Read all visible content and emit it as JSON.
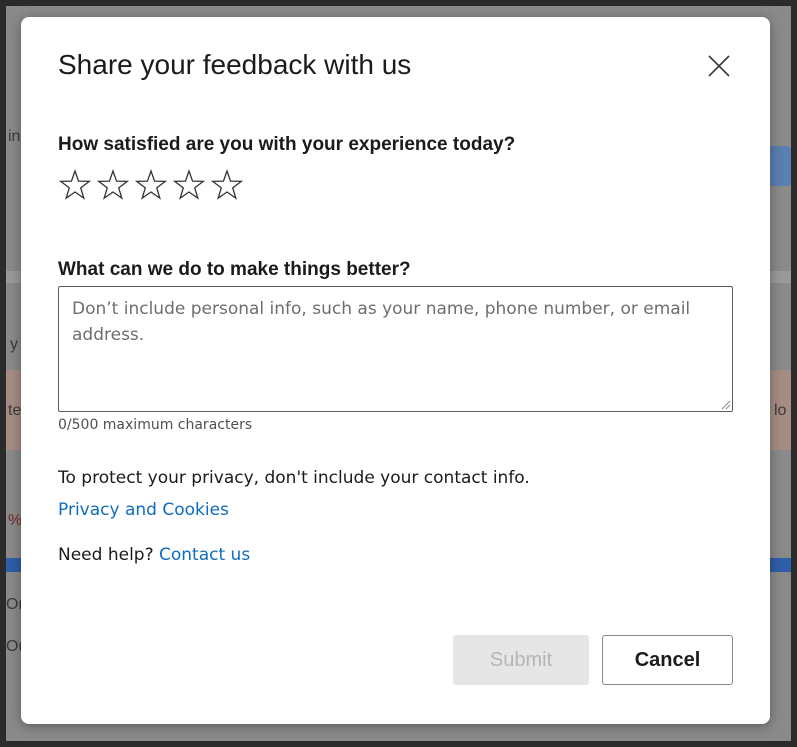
{
  "background": {
    "fragments": [
      "in",
      "y",
      "te",
      "%",
      "Or",
      "Ou",
      "lo"
    ]
  },
  "dialog": {
    "title": "Share your feedback with us",
    "satisfaction": {
      "question": "How satisfied are you with your experience today?",
      "rating": 0,
      "max_rating": 5
    },
    "improvement": {
      "question": "What can we do to make things better?",
      "value": "",
      "placeholder": "Don’t include personal info, such as your name, phone number, or email address.",
      "char_count": "0/500 maximum characters"
    },
    "privacy_note": "To protect your privacy, don't include your contact info.",
    "privacy_link": "Privacy and Cookies",
    "help": {
      "prefix": "Need help?",
      "link": "Contact us"
    },
    "buttons": {
      "submit": "Submit",
      "cancel": "Cancel"
    }
  },
  "colors": {
    "link": "#0f6cbd",
    "disabled_button_bg": "#e6e6e6",
    "disabled_button_text": "#b5b5b5",
    "overlay": "#8a8a8a"
  },
  "icons": {
    "close": "close-icon",
    "star": "star-outline-icon",
    "resize": "resize-grip-icon"
  }
}
